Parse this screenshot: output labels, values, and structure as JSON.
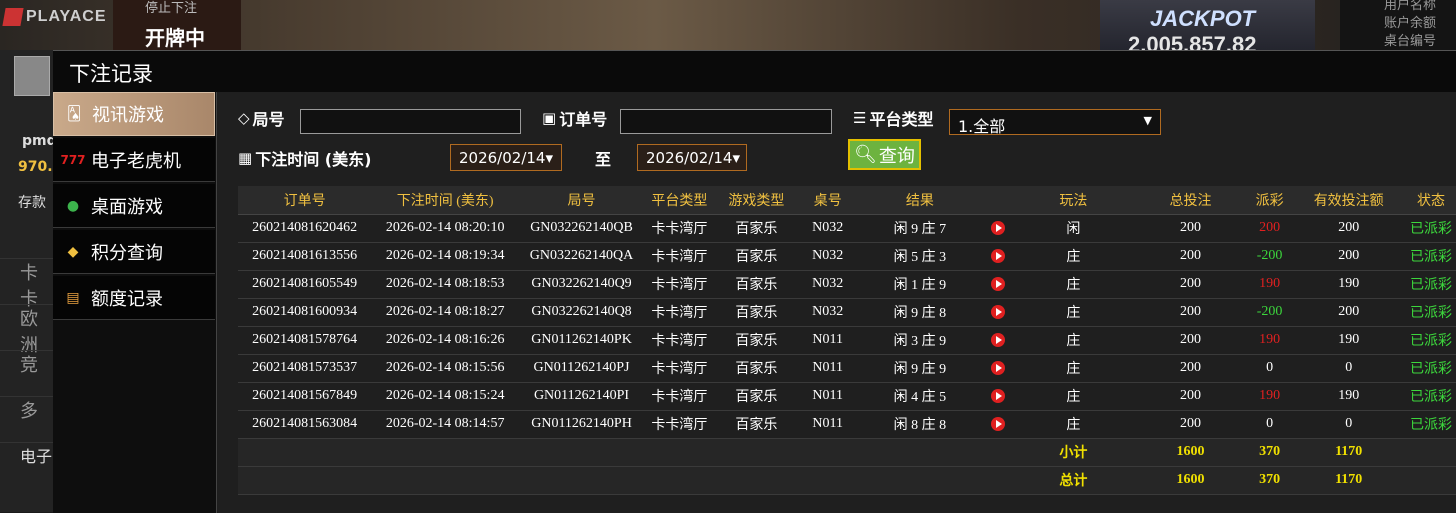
{
  "background": {
    "logo": "PLAYACE",
    "stop_bet": "停止下注",
    "dealing": "开牌中",
    "jackpot_label": "JACKPOT",
    "jackpot_value": "2,005,857.82",
    "right_lines": [
      "用户名称",
      "账户余额",
      "桌台编号"
    ],
    "side_user": "pmd",
    "side_balance": "970.",
    "side_deposit": "存款",
    "side_rows": [
      "卡卡",
      "欧洲",
      "竞",
      "多",
      "电子"
    ]
  },
  "modal": {
    "title": "下注记录",
    "menu": [
      {
        "label": "视讯游戏",
        "icon": "cards-icon"
      },
      {
        "label": "电子老虎机",
        "icon": "slot-777-icon"
      },
      {
        "label": "桌面游戏",
        "icon": "chips-icon"
      },
      {
        "label": "积分查询",
        "icon": "diamond-icon"
      },
      {
        "label": "额度记录",
        "icon": "document-icon"
      }
    ]
  },
  "filters": {
    "round_label": "局号",
    "order_label": "订单号",
    "platform_label": "平台类型",
    "platform_value": "1.全部",
    "time_label": "下注时间 (美东)",
    "date_from": "2026/02/14",
    "to_label": "至",
    "date_to": "2026/02/14",
    "query_label": "查询"
  },
  "table": {
    "headers": [
      "订单号",
      "下注时间 (美东)",
      "局号",
      "平台类型",
      "游戏类型",
      "桌号",
      "结果",
      "",
      "玩法",
      "总投注",
      "派彩",
      "有效投注额",
      "状态"
    ],
    "rows": [
      [
        "260214081620462",
        "2026-02-14 08:20:10",
        "GN032262140QB",
        "卡卡湾厅",
        "百家乐",
        "N032",
        "闲 9 庄 7",
        "闲",
        "200",
        "200",
        "200",
        "已派彩"
      ],
      [
        "260214081613556",
        "2026-02-14 08:19:34",
        "GN032262140QA",
        "卡卡湾厅",
        "百家乐",
        "N032",
        "闲 5 庄 3",
        "庄",
        "200",
        "-200",
        "200",
        "已派彩"
      ],
      [
        "260214081605549",
        "2026-02-14 08:18:53",
        "GN032262140Q9",
        "卡卡湾厅",
        "百家乐",
        "N032",
        "闲 1 庄 9",
        "庄",
        "200",
        "190",
        "190",
        "已派彩"
      ],
      [
        "260214081600934",
        "2026-02-14 08:18:27",
        "GN032262140Q8",
        "卡卡湾厅",
        "百家乐",
        "N032",
        "闲 9 庄 8",
        "庄",
        "200",
        "-200",
        "200",
        "已派彩"
      ],
      [
        "260214081578764",
        "2026-02-14 08:16:26",
        "GN011262140PK",
        "卡卡湾厅",
        "百家乐",
        "N011",
        "闲 3 庄 9",
        "庄",
        "200",
        "190",
        "190",
        "已派彩"
      ],
      [
        "260214081573537",
        "2026-02-14 08:15:56",
        "GN011262140PJ",
        "卡卡湾厅",
        "百家乐",
        "N011",
        "闲 9 庄 9",
        "庄",
        "200",
        "0",
        "0",
        "已派彩"
      ],
      [
        "260214081567849",
        "2026-02-14 08:15:24",
        "GN011262140PI",
        "卡卡湾厅",
        "百家乐",
        "N011",
        "闲 4 庄 5",
        "庄",
        "200",
        "190",
        "190",
        "已派彩"
      ],
      [
        "260214081563084",
        "2026-02-14 08:14:57",
        "GN011262140PH",
        "卡卡湾厅",
        "百家乐",
        "N011",
        "闲 8 庄 8",
        "庄",
        "200",
        "0",
        "0",
        "已派彩"
      ]
    ],
    "subtotal": {
      "label": "小计",
      "total_bet": "1600",
      "payout": "370",
      "valid_bet": "1170"
    },
    "total": {
      "label": "总计",
      "total_bet": "1600",
      "payout": "370",
      "valid_bet": "1170"
    }
  },
  "colors": {
    "accent_gold": "#f0c040",
    "win_red": "#e02020",
    "loss_green": "#3cd63c",
    "query_green": "#6db33f"
  }
}
